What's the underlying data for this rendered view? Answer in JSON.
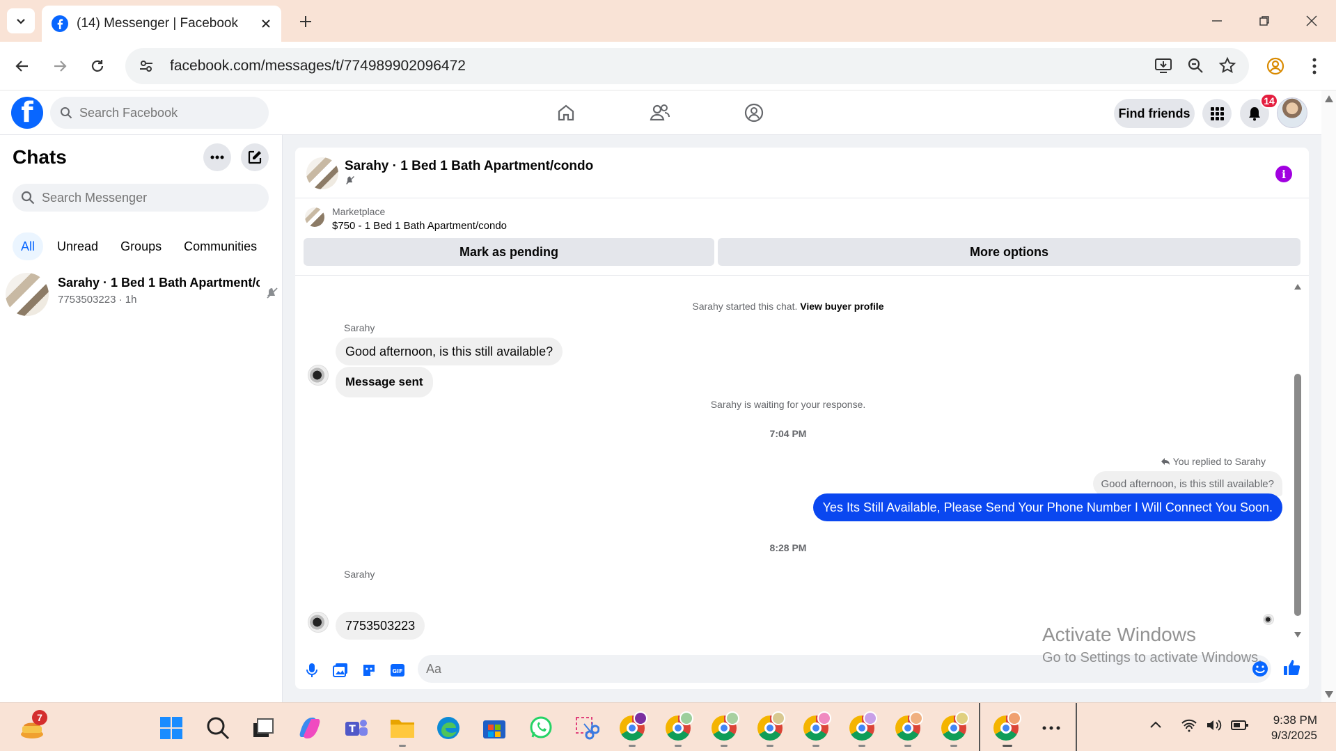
{
  "browser": {
    "tab_title": "(14) Messenger | Facebook",
    "url": "facebook.com/messages/t/774989902096472"
  },
  "fb": {
    "search_placeholder": "Search Facebook",
    "find_friends": "Find friends",
    "notification_count": "14"
  },
  "sidebar": {
    "title": "Chats",
    "search_placeholder": "Search Messenger",
    "filters": [
      "All",
      "Unread",
      "Groups",
      "Communities"
    ],
    "chats": [
      {
        "name": "Sarahy · 1 Bed 1 Bath Apartment/condo",
        "meta": "7753503223 · 1h"
      }
    ]
  },
  "conversation": {
    "title": "Sarahy · 1 Bed 1 Bath Apartment/condo",
    "marketplace_label": "Marketplace",
    "listing": "$750 - 1 Bed 1 Bath Apartment/condo",
    "mark_pending": "Mark as pending",
    "more_options": "More options",
    "started_text": "Sarahy started this chat.",
    "view_buyer": "View buyer profile",
    "sender_name": "Sarahy",
    "msg_in_1": "Good afternoon, is this still available?",
    "msg_in_2": "Message sent",
    "waiting": "Sarahy is waiting for your response.",
    "time_1": "7:04 PM",
    "replied_label": "You replied to Sarahy",
    "reply_quote": "Good afternoon, is this still available?",
    "msg_out": "Yes Its Still Available, Please Send Your Phone Number I Will Connect You Soon.",
    "time_2": "8:28 PM",
    "msg_in_3": "7753503223",
    "composer_placeholder": "Aa"
  },
  "watermark": {
    "line1": "Activate Windows",
    "line2": "Go to Settings to activate Windows."
  },
  "taskbar": {
    "widget_badge": "7",
    "time": "9:38 PM",
    "date": "9/3/2025"
  },
  "colors": {
    "fb_blue": "#0866ff",
    "outgoing_bubble": "#0a47f0",
    "info_purple": "#a100e0",
    "chrome_bg": "#f9e3d6"
  }
}
